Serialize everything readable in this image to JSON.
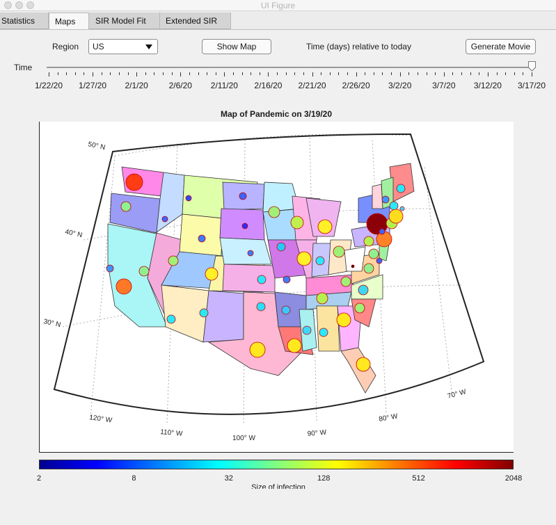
{
  "window": {
    "title": "UI Figure"
  },
  "tabs": [
    "Statistics",
    "Maps",
    "SIR Model Fit",
    "Extended SIR"
  ],
  "active_tab": "Maps",
  "controls": {
    "region_label": "Region",
    "region_value": "US",
    "show_map": "Show Map",
    "time_caption": "Time (days) relative to today",
    "generate_movie": "Generate Movie",
    "time_label": "Time",
    "time_ticks": [
      "1/22/20",
      "1/27/20",
      "2/1/20",
      "2/6/20",
      "2/11/20",
      "2/16/20",
      "2/21/20",
      "2/26/20",
      "3/2/20",
      "3/7/20",
      "3/12/20",
      "3/17/20"
    ],
    "slider_value": "3/19/20"
  },
  "map": {
    "title": "Map of Pandemic on 3/19/20",
    "lat_labels": [
      "50° N",
      "40° N",
      "30° N"
    ],
    "lon_labels": [
      "120° W",
      "110° W",
      "100° W",
      "90° W",
      "80° W",
      "70° W"
    ]
  },
  "colorbar": {
    "ticks": [
      "2",
      "8",
      "32",
      "128",
      "512",
      "2048"
    ],
    "title": "Size of infection",
    "colormap": "jet"
  }
}
